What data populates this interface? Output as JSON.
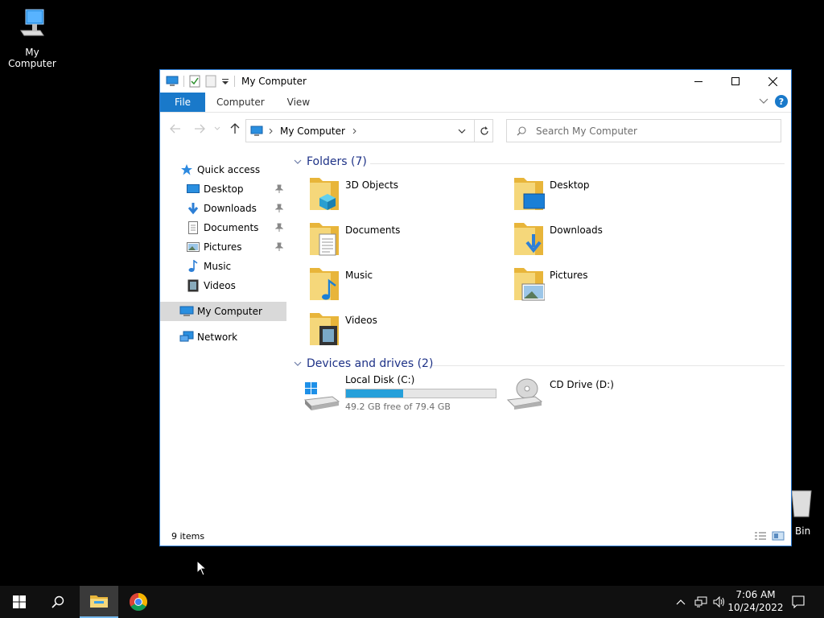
{
  "desktop": {
    "icons": [
      {
        "label": "My Computer"
      },
      {
        "label": "Bin"
      }
    ]
  },
  "window": {
    "title": "My Computer",
    "ribbon_tabs": [
      "File",
      "Computer",
      "View"
    ],
    "help_label": "?",
    "address": {
      "crumb": "My Computer"
    },
    "search": {
      "placeholder": "Search My Computer"
    },
    "nav_pane": {
      "quick_access": "Quick access",
      "quick_items": [
        {
          "label": "Desktop",
          "pinned": true
        },
        {
          "label": "Downloads",
          "pinned": true
        },
        {
          "label": "Documents",
          "pinned": true
        },
        {
          "label": "Pictures",
          "pinned": true
        },
        {
          "label": "Music",
          "pinned": false
        },
        {
          "label": "Videos",
          "pinned": false
        }
      ],
      "my_computer": "My Computer",
      "network": "Network"
    },
    "folders_group": {
      "header": "Folders (7)",
      "items": [
        "3D Objects",
        "Desktop",
        "Documents",
        "Downloads",
        "Music",
        "Pictures",
        "Videos"
      ]
    },
    "drives_group": {
      "header": "Devices and drives (2)",
      "drives": [
        {
          "label": "Local Disk (C:)",
          "free_text": "49.2 GB free of 79.4 GB",
          "used_fraction": 0.38
        },
        {
          "label": "CD Drive (D:)"
        }
      ]
    },
    "status": {
      "item_count": "9 items"
    }
  },
  "taskbar": {
    "clock_time": "7:06 AM",
    "clock_date": "10/24/2022"
  },
  "colors": {
    "accent": "#1979ca",
    "drive_fill": "#26a0da",
    "group_header": "#1e3287",
    "folder": "#f0c850"
  }
}
